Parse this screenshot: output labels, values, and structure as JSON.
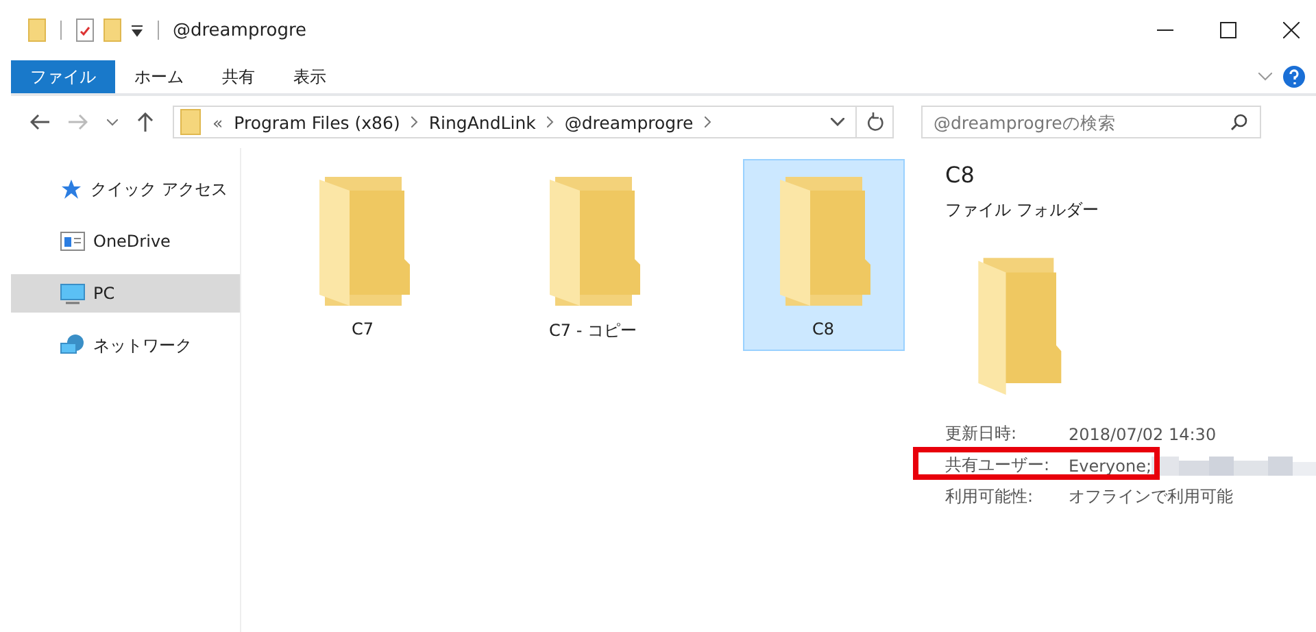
{
  "window": {
    "title": "@dreamprogre"
  },
  "ribbon_tabs": [
    {
      "label": "ファイル",
      "selected": true
    },
    {
      "label": "ホーム",
      "selected": false
    },
    {
      "label": "共有",
      "selected": false
    },
    {
      "label": "表示",
      "selected": false
    }
  ],
  "address_bar": {
    "overflow": "«",
    "path": [
      "Program Files (x86)",
      "RingAndLink",
      "@dreamprogre"
    ]
  },
  "search": {
    "placeholder": "@dreamprogreの検索"
  },
  "sidebar": {
    "items": [
      {
        "kind": "star",
        "label": "クイック アクセス",
        "selected": false
      },
      {
        "kind": "cloud",
        "label": "OneDrive",
        "selected": false
      },
      {
        "kind": "pc",
        "label": "PC",
        "selected": true
      },
      {
        "kind": "network",
        "label": "ネットワーク",
        "selected": false
      }
    ]
  },
  "folders": [
    {
      "name": "C7",
      "selected": false
    },
    {
      "name": "C7 - コピー",
      "selected": false
    },
    {
      "name": "C8",
      "selected": true
    }
  ],
  "details": {
    "name": "C8",
    "type": "ファイル フォルダー",
    "rows": [
      {
        "label": "更新日時:",
        "value": "2018/07/02 14:30",
        "highlighted": false,
        "redacted": false
      },
      {
        "label": "共有ユーザー:",
        "value": "Everyone;",
        "highlighted": true,
        "redacted": true
      },
      {
        "label": "利用可能性:",
        "value": "オフラインで利用可能",
        "highlighted": false,
        "redacted": false
      }
    ]
  }
}
